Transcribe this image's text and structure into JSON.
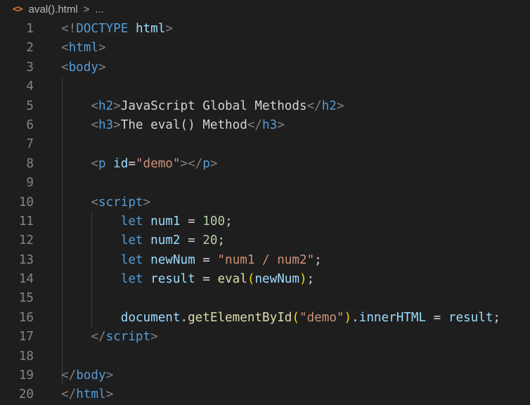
{
  "breadcrumb": {
    "icon": "html-file-icon",
    "file": "aval().html",
    "separator": ">",
    "more": "..."
  },
  "lines": [
    {
      "n": "1",
      "parts": [
        [
          "punct",
          "<!"
        ],
        [
          "doctype",
          "DOCTYPE"
        ],
        [
          "op",
          " "
        ],
        [
          "doctype-b",
          "html"
        ],
        [
          "punct",
          ">"
        ]
      ]
    },
    {
      "n": "2",
      "parts": [
        [
          "punct",
          "<"
        ],
        [
          "tag",
          "html"
        ],
        [
          "punct",
          ">"
        ]
      ]
    },
    {
      "n": "3",
      "parts": [
        [
          "punct",
          "<"
        ],
        [
          "tag",
          "body"
        ],
        [
          "punct",
          ">"
        ]
      ]
    },
    {
      "n": "4",
      "parts": []
    },
    {
      "n": "5",
      "parts": [
        [
          "op",
          "    "
        ],
        [
          "punct",
          "<"
        ],
        [
          "tag",
          "h2"
        ],
        [
          "punct",
          ">"
        ],
        [
          "text",
          "JavaScript Global Methods"
        ],
        [
          "punct",
          "</"
        ],
        [
          "tag",
          "h2"
        ],
        [
          "punct",
          ">"
        ]
      ]
    },
    {
      "n": "6",
      "parts": [
        [
          "op",
          "    "
        ],
        [
          "punct",
          "<"
        ],
        [
          "tag",
          "h3"
        ],
        [
          "punct",
          ">"
        ],
        [
          "text",
          "The eval() Method"
        ],
        [
          "punct",
          "</"
        ],
        [
          "tag",
          "h3"
        ],
        [
          "punct",
          ">"
        ]
      ]
    },
    {
      "n": "7",
      "parts": []
    },
    {
      "n": "8",
      "parts": [
        [
          "op",
          "    "
        ],
        [
          "punct",
          "<"
        ],
        [
          "tag",
          "p"
        ],
        [
          "op",
          " "
        ],
        [
          "attr",
          "id"
        ],
        [
          "op",
          "="
        ],
        [
          "str",
          "\"demo\""
        ],
        [
          "punct",
          "></"
        ],
        [
          "tag",
          "p"
        ],
        [
          "punct",
          ">"
        ]
      ]
    },
    {
      "n": "9",
      "parts": []
    },
    {
      "n": "10",
      "parts": [
        [
          "op",
          "    "
        ],
        [
          "punct",
          "<"
        ],
        [
          "tag",
          "script"
        ],
        [
          "punct",
          ">"
        ]
      ]
    },
    {
      "n": "11",
      "parts": [
        [
          "op",
          "        "
        ],
        [
          "kw",
          "let"
        ],
        [
          "op",
          " "
        ],
        [
          "var",
          "num1"
        ],
        [
          "op",
          " = "
        ],
        [
          "num",
          "100"
        ],
        [
          "op",
          ";"
        ]
      ]
    },
    {
      "n": "12",
      "parts": [
        [
          "op",
          "        "
        ],
        [
          "kw",
          "let"
        ],
        [
          "op",
          " "
        ],
        [
          "var",
          "num2"
        ],
        [
          "op",
          " = "
        ],
        [
          "num",
          "20"
        ],
        [
          "op",
          ";"
        ]
      ]
    },
    {
      "n": "13",
      "parts": [
        [
          "op",
          "        "
        ],
        [
          "kw",
          "let"
        ],
        [
          "op",
          " "
        ],
        [
          "var",
          "newNum"
        ],
        [
          "op",
          " = "
        ],
        [
          "str",
          "\"num1 / num2\""
        ],
        [
          "op",
          ";"
        ]
      ]
    },
    {
      "n": "14",
      "parts": [
        [
          "op",
          "        "
        ],
        [
          "kw",
          "let"
        ],
        [
          "op",
          " "
        ],
        [
          "var",
          "result"
        ],
        [
          "op",
          " = "
        ],
        [
          "fn",
          "eval"
        ],
        [
          "paren",
          "("
        ],
        [
          "var",
          "newNum"
        ],
        [
          "paren",
          ")"
        ],
        [
          "op",
          ";"
        ]
      ]
    },
    {
      "n": "15",
      "parts": []
    },
    {
      "n": "16",
      "parts": [
        [
          "op",
          "        "
        ],
        [
          "var",
          "document"
        ],
        [
          "op",
          "."
        ],
        [
          "fn",
          "getElementById"
        ],
        [
          "paren",
          "("
        ],
        [
          "str",
          "\"demo\""
        ],
        [
          "paren",
          ")"
        ],
        [
          "op",
          "."
        ],
        [
          "var",
          "innerHTML"
        ],
        [
          "op",
          " = "
        ],
        [
          "var",
          "result"
        ],
        [
          "op",
          ";"
        ]
      ]
    },
    {
      "n": "17",
      "parts": [
        [
          "op",
          "    "
        ],
        [
          "punct",
          "</"
        ],
        [
          "tag",
          "script"
        ],
        [
          "punct",
          ">"
        ]
      ]
    },
    {
      "n": "18",
      "parts": []
    },
    {
      "n": "19",
      "parts": [
        [
          "punct",
          "</"
        ],
        [
          "tag",
          "body"
        ],
        [
          "punct",
          ">"
        ]
      ]
    },
    {
      "n": "20",
      "parts": [
        [
          "punct",
          "</"
        ],
        [
          "tag",
          "html"
        ],
        [
          "punct",
          ">"
        ]
      ]
    }
  ]
}
